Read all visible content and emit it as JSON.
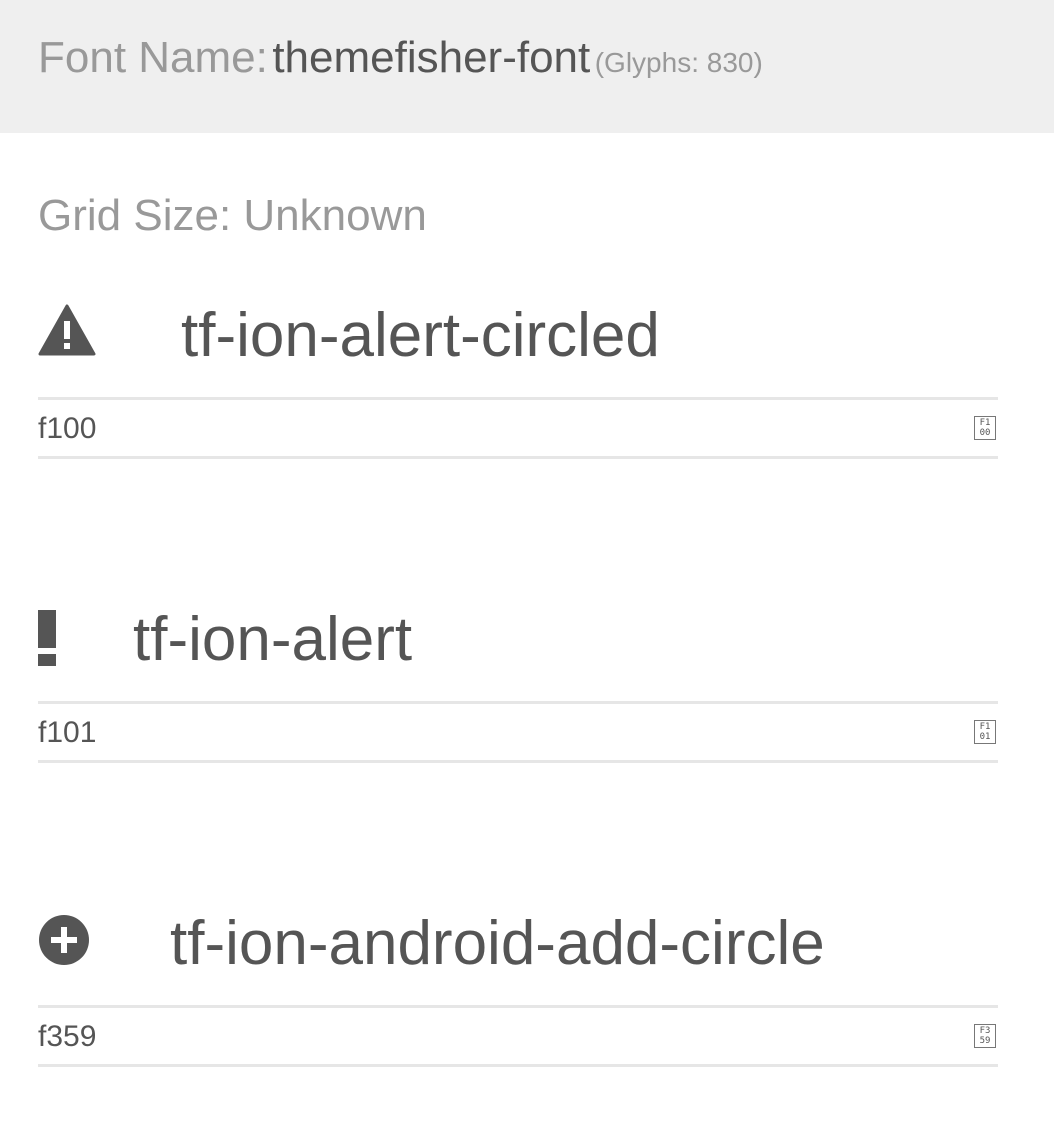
{
  "header": {
    "font_label": "Font Name:",
    "font_name": "themefisher-font",
    "glyph_count": "(Glyphs: 830)"
  },
  "grid": {
    "text": "Grid Size: Unknown"
  },
  "glyphs": [
    {
      "icon": "alert-triangle-icon",
      "name": "tf-ion-alert-circled",
      "code": "f100",
      "hex_top": "F1",
      "hex_bottom": "00"
    },
    {
      "icon": "exclamation-icon",
      "name": "tf-ion-alert",
      "code": "f101",
      "hex_top": "F1",
      "hex_bottom": "01"
    },
    {
      "icon": "add-circle-icon",
      "name": "tf-ion-android-add-circle",
      "code": "f359",
      "hex_top": "F3",
      "hex_bottom": "59"
    }
  ],
  "colors": {
    "header_bg": "#efefef",
    "muted_text": "#999999",
    "main_text": "#555555",
    "rule": "#e6e6e6"
  }
}
